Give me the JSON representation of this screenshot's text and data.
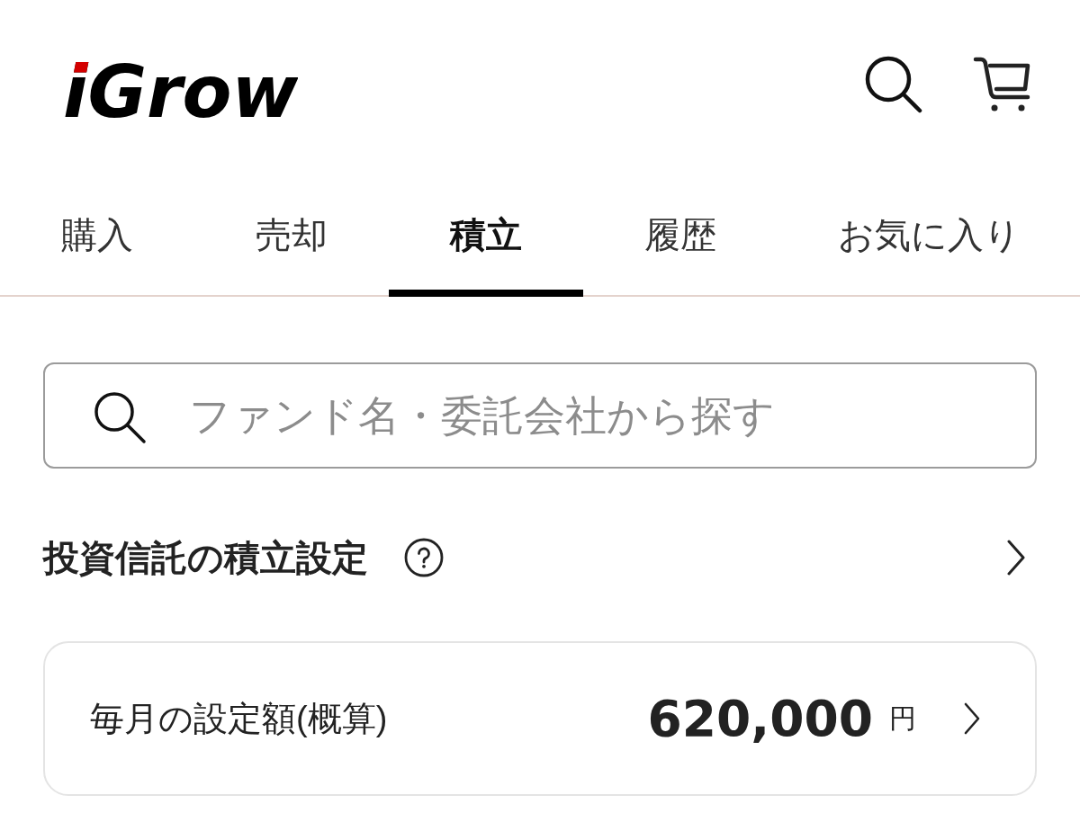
{
  "header": {
    "logo": "iGrow"
  },
  "tabs": [
    {
      "label": "購入",
      "selected": false
    },
    {
      "label": "売却",
      "selected": false
    },
    {
      "label": "積立",
      "selected": true
    },
    {
      "label": "履歴",
      "selected": false
    },
    {
      "label": "お気に入り",
      "selected": false
    }
  ],
  "search": {
    "placeholder": "ファンド名・委託会社から探す"
  },
  "section": {
    "title": "投資信託の積立設定"
  },
  "monthly_amount": {
    "label": "毎月の設定額(概算)",
    "value": "620,000",
    "unit": "円"
  }
}
